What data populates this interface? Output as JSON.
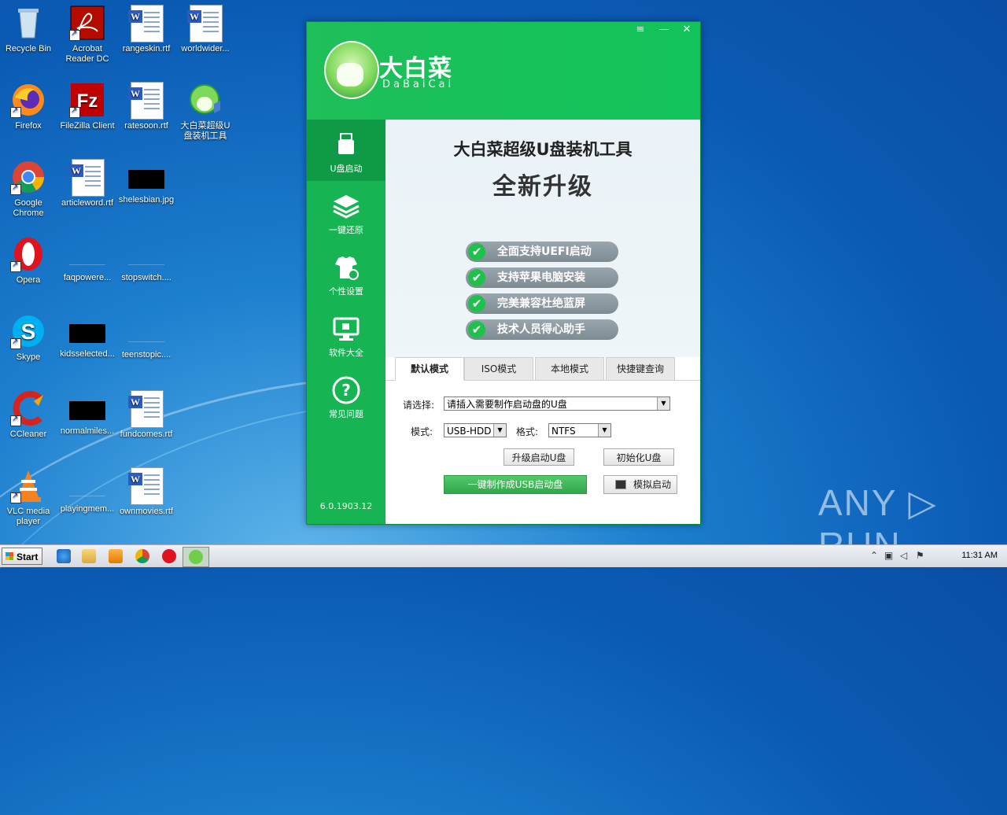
{
  "desktop": {
    "icons": [
      {
        "label": "Recycle Bin"
      },
      {
        "label": "Acrobat Reader DC"
      },
      {
        "label": "rangeskin.rtf"
      },
      {
        "label": "worldwider..."
      },
      {
        "label": "Firefox"
      },
      {
        "label": "FileZilla Client"
      },
      {
        "label": "ratesoon.rtf"
      },
      {
        "label": "大白菜超级U盘装机工具"
      },
      {
        "label": "Google Chrome"
      },
      {
        "label": "articleword.rtf"
      },
      {
        "label": "shelesbian.jpg"
      },
      {
        "label": "Opera"
      },
      {
        "label": "faqpowere..."
      },
      {
        "label": "stopswitch...."
      },
      {
        "label": "Skype"
      },
      {
        "label": "kidsselected..."
      },
      {
        "label": "teenstopic...."
      },
      {
        "label": "CCleaner"
      },
      {
        "label": "normalmiles..."
      },
      {
        "label": "fundcomes.rtf"
      },
      {
        "label": "VLC media player"
      },
      {
        "label": "playingmem..."
      },
      {
        "label": "ownmovies.rtf"
      }
    ]
  },
  "app": {
    "brand_cn": "大白菜",
    "brand_en": "DaBaiCai",
    "window_controls": {
      "menu": "≡",
      "minimize": "—",
      "close": "✕"
    },
    "sidebar": [
      {
        "label": "U盘启动"
      },
      {
        "label": "一键还原"
      },
      {
        "label": "个性设置"
      },
      {
        "label": "软件大全"
      },
      {
        "label": "常见问题"
      }
    ],
    "version": "6.0.1903.12",
    "banner": {
      "title": "大白菜超级U盘装机工具",
      "subtitle": "全新升级",
      "features": [
        "全面支持UEFI启动",
        "支持苹果电脑安装",
        "完美兼容杜绝蓝屏",
        "技术人员得心助手"
      ]
    },
    "tabs": [
      {
        "label": "默认模式"
      },
      {
        "label": "ISO模式"
      },
      {
        "label": "本地模式"
      },
      {
        "label": "快捷键查询"
      }
    ],
    "form": {
      "select_label": "请选择:",
      "select_value": "请插入需要制作启动盘的U盘",
      "mode_label": "模式:",
      "mode_value": "USB-HDD",
      "format_label": "格式:",
      "format_value": "NTFS",
      "upgrade_button": "升级启动U盘",
      "init_button": "初始化U盘",
      "make_button": "一键制作成USB启动盘",
      "simulate_button": "模拟启动"
    }
  },
  "taskbar": {
    "start_label": "Start",
    "clock": "11:31 AM"
  },
  "watermark": "ANY ▷ RUN"
}
